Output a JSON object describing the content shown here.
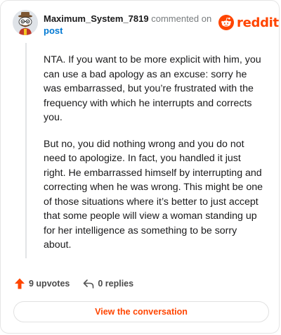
{
  "comment": {
    "author": "Maximum_System_7819",
    "commented_on_label": "commented on",
    "post_link": "post",
    "paragraphs": [
      "NTA. If you want to be more explicit with him, you can use a bad apology as an excuse: sorry he was embarrassed, but you’re frustrated with the frequency with which he interrupts and corrects you.",
      "But no, you did nothing wrong and you do not need to apologize. In fact, you handled it just right. He embarrassed himself by interrupting and correcting when he was wrong. This might be one of those situations where it’s better to just accept that some people will view a woman standing up for her intelligence as something to be sorry about."
    ],
    "upvotes_label": "9 upvotes",
    "replies_label": "0 replies"
  },
  "brand": {
    "name": "reddit",
    "color": "#ff4500",
    "icon": "reddit-snoo-icon"
  },
  "colors": {
    "link": "#0079d3",
    "upvote": "#ff4500"
  },
  "footer": {
    "view_conversation_label": "View the conversation"
  }
}
